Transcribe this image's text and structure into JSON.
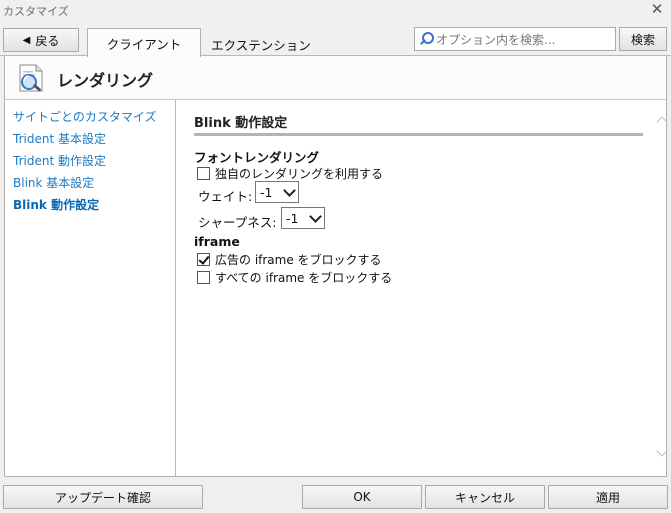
{
  "window": {
    "title": "カスタマイズ",
    "close_glyph": "✕"
  },
  "toolbar": {
    "back_label": "戻る",
    "tabs": [
      {
        "label": "クライアント",
        "active": true
      },
      {
        "label": "エクステンション",
        "active": false
      }
    ],
    "search_placeholder": "オプション内を検索...",
    "search_button": "検索"
  },
  "header": {
    "title": "レンダリング",
    "icon": "rendering-page-icon"
  },
  "sidebar": {
    "items": [
      {
        "label": "サイトごとのカスタマイズ",
        "selected": false
      },
      {
        "label": "Trident 基本設定",
        "selected": false
      },
      {
        "label": "Trident 動作設定",
        "selected": false
      },
      {
        "label": "Blink 基本設定",
        "selected": false
      },
      {
        "label": "Blink 動作設定",
        "selected": true
      }
    ]
  },
  "content": {
    "section_title": "Blink 動作設定",
    "font_group": {
      "title": "フォントレンダリング",
      "custom_rendering_label": "独自のレンダリングを利用する",
      "custom_rendering_checked": false,
      "weight_label": "ウェイト:",
      "weight_value": "-1",
      "sharpness_label": "シャープネス:",
      "sharpness_value": "-1"
    },
    "iframe_group": {
      "title": "iframe",
      "block_ad_label": "広告の iframe をブロックする",
      "block_ad_checked": true,
      "block_all_label": "すべての iframe をブロックする",
      "block_all_checked": false
    }
  },
  "footer": {
    "update_button": "アップデート確認",
    "ok_button": "OK",
    "cancel_button": "キャンセル",
    "apply_button": "適用"
  },
  "colors": {
    "link": "#1a7bc4",
    "accent_icon": "#3a74c4"
  }
}
